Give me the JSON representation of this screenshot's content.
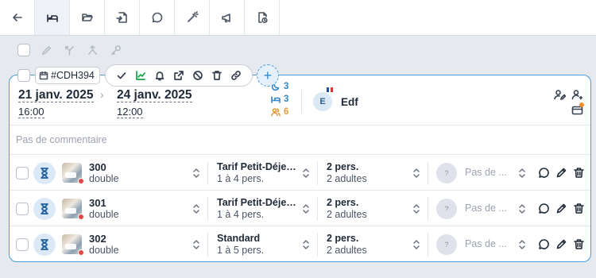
{
  "toolbar": {
    "buttons": [
      {
        "icon": "arrow-left-icon"
      },
      {
        "icon": "bed-icon",
        "active": true
      },
      {
        "icon": "folder-open-icon"
      },
      {
        "icon": "file-import-icon"
      },
      {
        "icon": "chat-icon"
      },
      {
        "icon": "magic-wand-icon"
      },
      {
        "icon": "megaphone-icon"
      },
      {
        "icon": "file-clock-icon"
      }
    ]
  },
  "bulk_actions": [
    "pencil-icon",
    "merge-icon",
    "split-icon",
    "key-icon"
  ],
  "booking": {
    "id": "#CDH394",
    "checkin": {
      "date": "21 janv. 2025",
      "time": "16:00"
    },
    "checkout": {
      "date": "24 janv. 2025",
      "time": "12:00"
    },
    "nights": "3",
    "rooms_count": "3",
    "guests_count": "6",
    "colors": {
      "nights": "#2f86c9",
      "rooms": "#2f86c9",
      "guests": "#e59b3c",
      "accent": "#4a9fd6"
    },
    "guest": {
      "initial": "E",
      "name": "Edf",
      "flag": "France"
    },
    "comment_placeholder": "Pas de commentaire",
    "add_button": "+"
  },
  "rooms": [
    {
      "number": "300",
      "type": "double",
      "rate": "Tarif Petit-Déjeuner",
      "capacity": "1 à 4 pers.",
      "persons": "2 pers.",
      "persons_detail": "2 adultes",
      "badge": "?",
      "note": "Pas de ..."
    },
    {
      "number": "301",
      "type": "double",
      "rate": "Tarif Petit-Déjeuner",
      "capacity": "1 à 4 pers.",
      "persons": "2 pers.",
      "persons_detail": "2 adultes",
      "badge": "?",
      "note": "Pas de ..."
    },
    {
      "number": "302",
      "type": "double",
      "rate": "Standard",
      "capacity": "1 à 5 pers.",
      "persons": "2 pers.",
      "persons_detail": "2 adultes",
      "badge": "?",
      "note": "Pas de ..."
    }
  ]
}
